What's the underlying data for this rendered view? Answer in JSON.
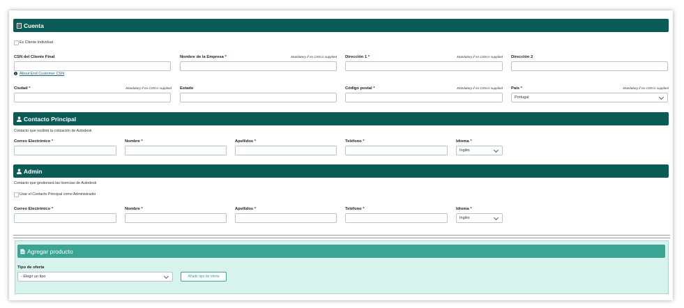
{
  "cuenta": {
    "title": "Cuenta",
    "individual_checkbox_label": "Es Cliente Individual",
    "csn_label": "CSN del Cliente Final",
    "empresa_label": "Nombre de la Empresa",
    "direccion1_label": "Dirección 1",
    "direccion2_label": "Dirección 2",
    "mandatory_note": "Mandatory if no CSN is supplied",
    "about_link": "About End Customer CSN",
    "ciudad_label": "Ciudad",
    "estado_label": "Estado",
    "cp_label": "Código postal",
    "pais_label": "País",
    "pais_value": "Portugal",
    "required_mark": "*"
  },
  "contacto": {
    "title": "Contacto Principal",
    "description": "Contacto que recibirá la cotización de Autodesk",
    "email_label": "Correo Electrónico",
    "nombre_label": "Nombre",
    "apellidos_label": "Apellidos",
    "telefono_label": "Teléfono",
    "idioma_label": "Idioma",
    "idioma_value": "Inglés"
  },
  "admin": {
    "title": "Admin",
    "description": "Contacto que gestionará las licencias de Autodesk",
    "use_contact_label": "Usar el Contacto Principal como Administrador",
    "email_label": "Correo Electrónico",
    "nombre_label": "Nombre",
    "apellidos_label": "Apellidos",
    "telefono_label": "Teléfono",
    "idioma_label": "Idioma",
    "idioma_value": "Inglés"
  },
  "producto": {
    "title": "Agregar producto",
    "tipo_label": "Tipo de oferta",
    "tipo_value": "- Elegir un tipo",
    "add_button": "Añadir tipo de oferta"
  },
  "icons": {
    "cuenta": "building-icon",
    "contacto": "user-icon",
    "admin": "user-icon",
    "producto": "document-icon",
    "info": "info-icon"
  },
  "colors": {
    "header_bg": "#0b5c57",
    "product_header_bg": "#3aa592",
    "product_panel_bg": "#d8f3ee",
    "required": "#cc0000",
    "link": "#1c5f8a"
  }
}
